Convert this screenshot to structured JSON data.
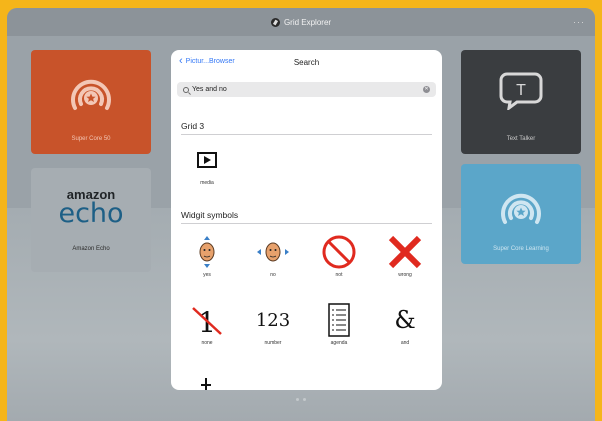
{
  "window": {
    "title": "Grid Explorer",
    "more_label": "···"
  },
  "tiles": {
    "core50": {
      "label": "Super Core 50"
    },
    "echo": {
      "logo_line1": "amazon",
      "logo_line2": "echo",
      "label": "Amazon Echo"
    },
    "texttalker": {
      "label": "Text Talker",
      "glyph": "T"
    },
    "learning": {
      "label": "Super Core Learning"
    }
  },
  "modal": {
    "back_label": "Pictur...Browser",
    "title": "Search",
    "search": {
      "value": "Yes and no"
    },
    "sections": [
      {
        "title": "Grid 3",
        "items": [
          {
            "label": "media",
            "icon": "media-play-icon"
          }
        ]
      },
      {
        "title": "Widgit symbols",
        "items": [
          {
            "label": "yes",
            "icon": "face-yes-icon"
          },
          {
            "label": "no",
            "icon": "face-no-icon"
          },
          {
            "label": "not",
            "icon": "prohibition-icon"
          },
          {
            "label": "wrong",
            "icon": "red-cross-icon"
          },
          {
            "label": "none",
            "icon": "crossed-one-icon",
            "glyph": "1"
          },
          {
            "label": "number",
            "icon": "number-icon",
            "glyph": "123"
          },
          {
            "label": "agenda",
            "icon": "agenda-icon"
          },
          {
            "label": "and",
            "icon": "ampersand-icon",
            "glyph": "&"
          }
        ]
      }
    ]
  },
  "colors": {
    "frame": "#f5b51a",
    "accent": "#3478f6",
    "core50": "#c8532a",
    "texttalker": "#3a3d40",
    "learning": "#5ba6c9",
    "danger": "#e02a1f"
  }
}
